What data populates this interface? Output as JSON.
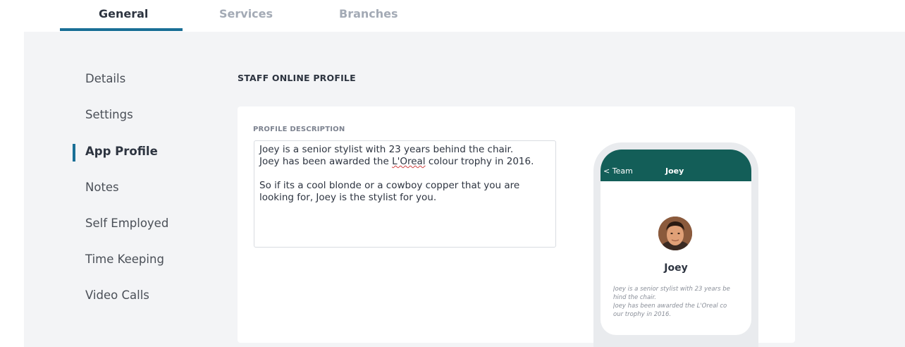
{
  "tabs": [
    {
      "label": "General",
      "active": true
    },
    {
      "label": "Services",
      "active": false
    },
    {
      "label": "Branches",
      "active": false
    }
  ],
  "sidenav": {
    "items": [
      {
        "label": "Details"
      },
      {
        "label": "Settings"
      },
      {
        "label": "App Profile",
        "active": true
      },
      {
        "label": "Notes"
      },
      {
        "label": "Self Employed"
      },
      {
        "label": "Time Keeping"
      },
      {
        "label": "Video Calls"
      }
    ]
  },
  "section": {
    "title": "STAFF ONLINE PROFILE"
  },
  "profile": {
    "field_label": "PROFILE DESCRIPTION",
    "description_line1": "Joey is a senior stylist with 23 years behind the chair.",
    "description_line2_pre": "Joey has been awarded the ",
    "description_line2_misspelled": "L'Oreal",
    "description_line2_post": " colour trophy in 2016.",
    "description_line3": "So if its a cool blonde or a cowboy copper that you are looking for, Joey is the stylist for you."
  },
  "preview": {
    "back_label": "< Team",
    "header_title": "Joey",
    "name": "Joey",
    "description": "Joey is a senior stylist with 23 years be\nhind the chair.\nJoey has been awarded the L'Oreal co\nour trophy in 2016.",
    "header_color": "#135e58"
  },
  "colors": {
    "accent": "#1a6f96",
    "background": "#f3f4f6"
  }
}
